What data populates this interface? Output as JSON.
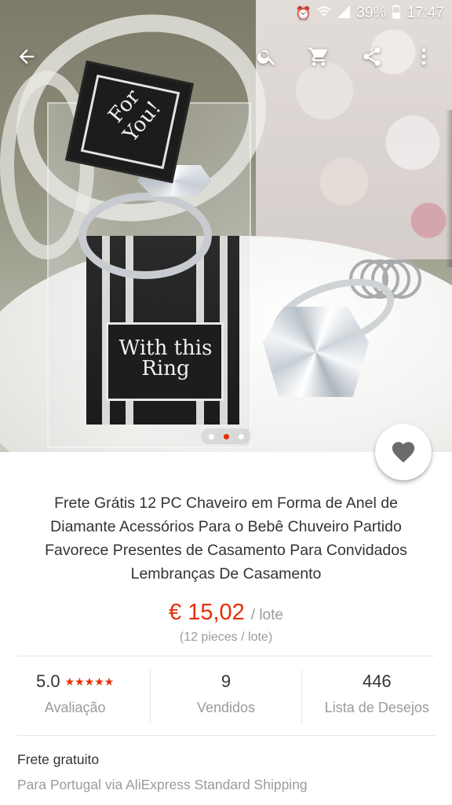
{
  "status_bar": {
    "battery": "39%",
    "time": "17:47",
    "alarm_icon": "alarm-icon",
    "wifi_icon": "wifi-icon",
    "signal_icon": "signal-icon",
    "battery_icon": "battery-icon"
  },
  "toolbar": {
    "back_icon": "arrow-back-icon",
    "search_icon": "search-icon",
    "cart_icon": "cart-icon",
    "share_icon": "share-icon",
    "more_icon": "more-vert-icon"
  },
  "gallery": {
    "image_count": 3,
    "active_index": 1,
    "tag_text": "For You!",
    "box_label_text": "With this Ring"
  },
  "product": {
    "title": "Frete Grátis 12 PC Chaveiro em Forma de Anel de Diamante Acessórios Para o Bebê Chuveiro Partido Favorece Presentes de Casamento Para Convidados Lembranças De Casamento",
    "price": "€ 15,02",
    "price_unit": "/ lote",
    "pieces": "(12 pieces / lote)"
  },
  "stats": {
    "rating_value": "5.0",
    "rating_stars": "★★★★★",
    "rating_label": "Avaliação",
    "sold_value": "9",
    "sold_label": "Vendidos",
    "wishlist_value": "446",
    "wishlist_label": "Lista de Desejos"
  },
  "shipping": {
    "title": "Frete gratuito",
    "subtitle": "Para Portugal via AliExpress Standard Shipping"
  },
  "colors": {
    "accent": "#e62e04",
    "text_primary": "#333333",
    "text_secondary": "#9b9b9b"
  }
}
